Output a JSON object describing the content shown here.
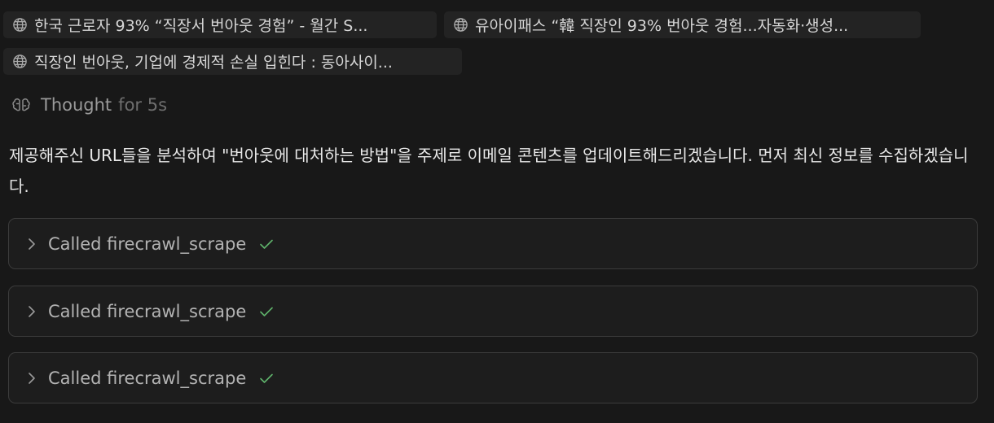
{
  "sources": [
    {
      "icon": "globe-icon",
      "title": "한국 근로자 93% “직장서 번아웃 경험” - 월간 S..."
    },
    {
      "icon": "globe-icon",
      "title": "유아이패스 “韓 직장인 93% 번아웃 경험...자동화·생성..."
    },
    {
      "icon": "globe-icon",
      "title": "직장인 번아웃, 기업에 경제적 손실 입힌다 : 동아사이..."
    }
  ],
  "thought": {
    "label": "Thought",
    "duration": "for 5s",
    "icon": "brain-icon"
  },
  "message": "제공해주신 URL들을 분석하여 \"번아웃에 대처하는 방법\"을 주제로 이메일 콘텐츠를 업데이트해드리겠습니다. 먼저 최신 정보를 수집하겠습니다.",
  "tool_calls": [
    {
      "label": "Called firecrawl_scrape",
      "status_icon": "check-icon"
    },
    {
      "label": "Called firecrawl_scrape",
      "status_icon": "check-icon"
    },
    {
      "label": "Called firecrawl_scrape",
      "status_icon": "check-icon"
    }
  ],
  "colors": {
    "background": "#181818",
    "chip": "#232323",
    "success": "#5fb36b"
  }
}
